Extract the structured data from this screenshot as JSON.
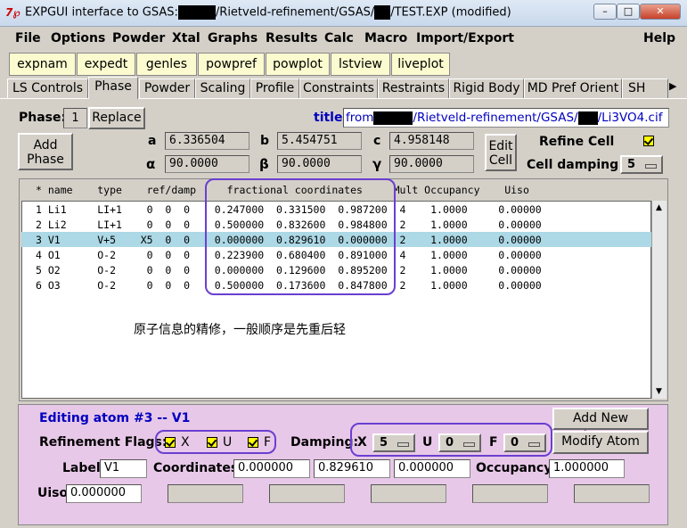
{
  "window": {
    "title_prefix": "EXPGUI interface to GSAS:",
    "title_mid": "/Rietveld-refinement/GSAS/",
    "title_suffix": "/TEST.EXP (modified)"
  },
  "menu": [
    "File",
    "Options",
    "Powder",
    "Xtal",
    "Graphs",
    "Results",
    "Calc",
    "Macro",
    "Import/Export",
    "Help"
  ],
  "toolbar": [
    "expnam",
    "expedt",
    "genles",
    "powpref",
    "powplot",
    "lstview",
    "liveplot"
  ],
  "tabs": [
    "LS Controls",
    "Phase",
    "Powder",
    "Scaling",
    "Profile",
    "Constraints",
    "Restraints",
    "Rigid Body",
    "MD Pref Orient",
    "SH Pre"
  ],
  "phase": {
    "label": "Phase:",
    "number": "1",
    "replace_label": "Replace",
    "add_phase_label": "Add\nPhase",
    "title_label": "title:",
    "title_from": "from",
    "title_path": "/Rietveld-refinement/GSAS/",
    "title_file": "/Li3VO4.cif"
  },
  "cell": {
    "a_label": "a",
    "a": "6.336504",
    "b_label": "b",
    "b": "5.454751",
    "c_label": "c",
    "c": "4.958148",
    "alpha_label": "α",
    "alpha": "90.0000",
    "beta_label": "β",
    "beta": "90.0000",
    "gamma_label": "γ",
    "gamma": "90.0000",
    "edit_cell_label": "Edit\nCell",
    "refine_cell_label": "Refine Cell",
    "cell_damping_label": "Cell damping",
    "cell_damping_value": "5"
  },
  "atom_table": {
    "header": "* name    type    ref/damp     fractional coordinates     Mult Occupancy    Uiso",
    "rows": [
      "1 Li1     LI+1    0  0  0    0.247000  0.331500  0.987200  4    1.0000     0.00000",
      "2 Li2     LI+1    0  0  0    0.500000  0.832600  0.984800  2    1.0000     0.00000",
      "3 V1      V+5    X5  0  0    0.000000  0.829610  0.000000  2    1.0000     0.00000",
      "4 O1      O-2     0  0  0    0.223900  0.680400  0.891000  4    1.0000     0.00000",
      "5 O2      O-2     0  0  0    0.000000  0.129600  0.895200  2    1.0000     0.00000",
      "6 O3      O-2     0  0  0    0.500000  0.173600  0.847800  2    1.0000     0.00000"
    ],
    "selected_row": 2
  },
  "annotation_text": "原子信息的精修，一般顺序是先重后轻",
  "editing": {
    "heading": "Editing atom #3 -- V1",
    "add_new_atoms": "Add New Atoms",
    "modify_atom": "Modify Atom",
    "flags_label": "Refinement Flags:",
    "flag_x": "X",
    "flag_u": "U",
    "flag_f": "F",
    "damping_label": "Damping:",
    "damp_x_label": "X",
    "damp_x": "5",
    "damp_u_label": "U",
    "damp_u": "0",
    "damp_f_label": "F",
    "damp_f": "0",
    "label_label": "Label",
    "label_value": "V1",
    "coords_label": "Coordinates",
    "coord_x": "0.000000",
    "coord_y": "0.829610",
    "coord_z": "0.000000",
    "occupancy_label": "Occupancy",
    "occupancy": "1.000000",
    "uiso_label": "Uiso",
    "uiso": "0.000000"
  },
  "colors": {
    "toolbar_bg": "#fbfbcf",
    "edit_panel_bg": "#e8c8e8",
    "selected_row": "#add8e6",
    "title_link": "#0000c0",
    "annotation": "#6a3fd0"
  }
}
